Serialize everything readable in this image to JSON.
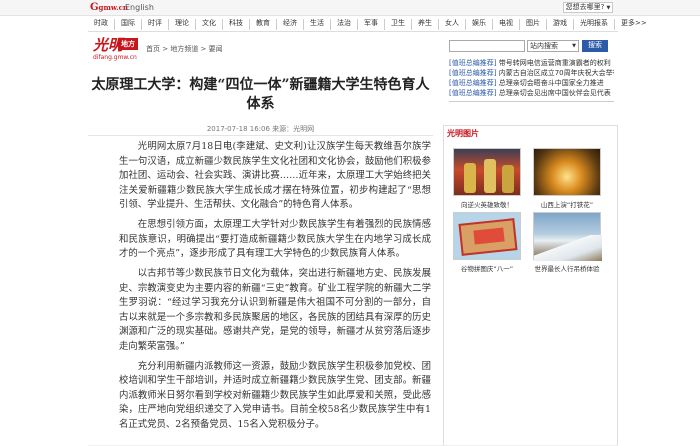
{
  "topbar": {
    "logo_text": "G",
    "logo_domain": "gmw.cn",
    "lang_label": "English",
    "login_label": "您想去哪里?"
  },
  "nav": [
    "时政",
    "国际",
    "时评",
    "理论",
    "文化",
    "科技",
    "教育",
    "经济",
    "生活",
    "法治",
    "军事",
    "卫生",
    "养生",
    "女人",
    "娱乐",
    "电视",
    "图片",
    "游戏",
    "光明报系",
    "更多>>"
  ],
  "site": {
    "logo_main": "光明",
    "logo_section": "地方",
    "logo_url": "difang.gmw.cn",
    "breadcrumb": "首页 > 地方频道 > 要闻"
  },
  "search": {
    "placeholder": "",
    "scope": "站内搜索",
    "button": "搜索"
  },
  "side_news": [
    {
      "tag": "[值班总编推荐]",
      "text": " 带号转网电信运营商重演霸者的权利"
    },
    {
      "tag": "[值班总编推荐]",
      "text": " 内蒙古自治区成立70周年庆祝大会举行"
    },
    {
      "tag": "[值班总编推荐]",
      "text": " 总理亲切会晤奋斗中国家全力推进"
    },
    {
      "tag": "[值班总编推荐]",
      "text": " 总理亲切会见出席中国伙伴会见代表"
    }
  ],
  "article": {
    "title": "太原理工大学：构建“四位一体”新疆籍大学生特色育人体系",
    "meta": "2017-07-18 16:06   来源：光明网",
    "paragraphs": [
      "光明网太原7月18日电(李建斌、史文利)让汉族学生每天教维吾尔族学生一句汉语，成立新疆少数民族学生文化社团和文化协会，鼓励他们积极参加社团、运动会、社会实践、演讲比赛……近年来，太原理工大学始终把关注关爱新疆籍少数民族大学生成长成才摆在特殊位置，初步构建起了“思想引领、学业提升、生活帮扶、文化融合”的特色育人体系。",
      "在思想引领方面，太原理工大学针对少数民族学生有着强烈的民族情感和民族意识，明确提出“要打造成新疆籍少数民族大学生在内地学习成长成才的一个亮点”，逐步形成了具有理工大学特色的少数民族育人体系。",
      "以古邦节等少数民族节日文化为载体，突出进行新疆地方史、民族发展史、宗教演变史为主要内容的新疆“三史”教育。矿业工程学院的新疆大二学生罗羽说：“经过学习我充分认识到新疆是伟大祖国不可分割的一部分，自古以来就是一个多宗教和多民族聚居的地区，各民族的团结具有深厚的历史渊源和广泛的现实基础。感谢共产党，是党的领导，新疆才从贫穷落后逐步走向繁荣富强。”",
      "充分利用新疆内派教师这一资源，鼓励少数民族学生积极参加党校、团校培训和学生干部培训，并适时成立新疆籍少数民族学生党、团支部。新疆内派教师米日努尔看到学校对新疆籍少数民族学生如此厚爱和关照，受此感染，庄严地向党组织递交了入党申请书。目前全校58名少数民族学生中有1名正式党员、2名预备党员、15名入党积极分子。"
    ]
  },
  "photos": {
    "heading": "光明图片",
    "items": [
      {
        "caption": "向逆火英雄致敬！",
        "icon": "firefighters-photo"
      },
      {
        "caption": "山西上演“打铁花”",
        "icon": "sparks-photo"
      },
      {
        "caption": "谷物拼图庆“八一”",
        "icon": "grain-art-photo"
      },
      {
        "caption": "世界最长人行吊桥体验",
        "icon": "suspension-bridge-photo"
      }
    ]
  },
  "colors": {
    "brand_red": "#c8161d",
    "link_blue": "#2b5aa8"
  }
}
